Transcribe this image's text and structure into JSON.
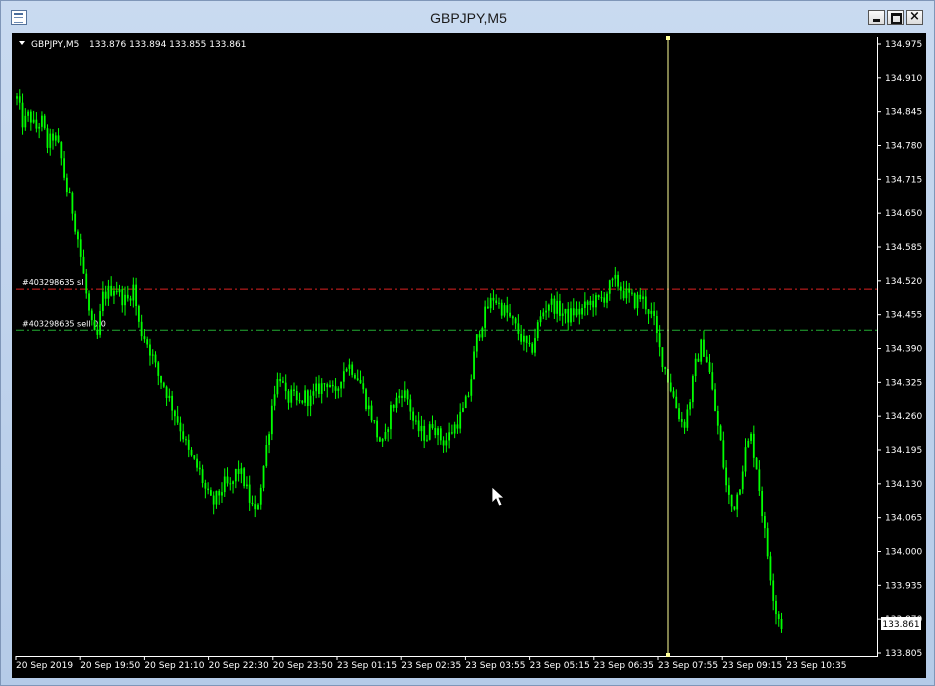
{
  "window": {
    "title": "GBPJPY,M5",
    "controls": [
      "minimize",
      "maximize",
      "close"
    ],
    "close_glyph": "×"
  },
  "chart_data": {
    "type": "candlestick",
    "symbol": "GBPJPY,M5",
    "ohlc_header": "133.876 133.894 133.855 133.861",
    "ylim": [
      133.805,
      134.975
    ],
    "y_ticks": [
      "134.975",
      "134.910",
      "134.845",
      "134.780",
      "134.715",
      "134.650",
      "134.585",
      "134.520",
      "134.455",
      "134.390",
      "134.325",
      "134.260",
      "134.195",
      "134.130",
      "134.065",
      "134.000",
      "133.935",
      "133.870",
      "133.805"
    ],
    "x_ticks": [
      "20 Sep 2019",
      "20 Sep 19:50",
      "20 Sep 21:10",
      "20 Sep 22:30",
      "20 Sep 23:50",
      "23 Sep 01:15",
      "23 Sep 02:35",
      "23 Sep 03:55",
      "23 Sep 05:15",
      "23 Sep 06:35",
      "23 Sep 07:55",
      "23 Sep 09:15",
      "23 Sep 10:35"
    ],
    "current_price": "133.861",
    "grid": false,
    "candle_color": "#00ff00",
    "background": "#000000",
    "close_series": [
      134.87,
      134.82,
      134.84,
      134.81,
      134.83,
      134.78,
      134.8,
      134.77,
      134.7,
      134.66,
      134.6,
      134.52,
      134.44,
      134.4,
      134.49,
      134.5,
      134.51,
      134.49,
      134.48,
      134.51,
      134.43,
      134.41,
      134.38,
      134.34,
      134.32,
      134.29,
      134.26,
      134.23,
      134.19,
      134.17,
      134.15,
      134.11,
      134.09,
      134.11,
      134.13,
      134.12,
      134.16,
      134.14,
      134.1,
      134.07,
      134.14,
      134.22,
      134.31,
      134.34,
      134.29,
      134.3,
      134.28,
      134.3,
      134.29,
      134.31,
      134.32,
      134.33,
      134.29,
      134.34,
      134.36,
      134.35,
      134.33,
      134.29,
      134.26,
      134.22,
      134.2,
      134.27,
      134.29,
      134.31,
      134.29,
      134.24,
      134.23,
      134.22,
      134.25,
      134.22,
      134.21,
      134.23,
      134.25,
      134.27,
      134.31,
      134.4,
      134.44,
      134.47,
      134.49,
      134.47,
      134.46,
      134.44,
      134.42,
      134.4,
      134.38,
      134.43,
      134.46,
      134.48,
      134.47,
      134.46,
      134.45,
      134.46,
      134.46,
      134.47,
      134.48,
      134.48,
      134.49,
      134.51,
      134.52,
      134.5,
      134.49,
      134.48,
      134.49,
      134.47,
      134.45,
      134.39,
      134.35,
      134.31,
      134.27,
      134.24,
      134.29,
      134.36,
      134.4,
      134.36,
      134.28,
      134.21,
      134.12,
      134.08,
      134.12,
      134.19,
      134.22,
      134.16,
      134.06,
      133.97,
      133.89,
      133.86
    ]
  },
  "orders": [
    {
      "label": "#403298635 sl",
      "price": 134.504,
      "color": "#dd2222"
    },
    {
      "label": "#403298635 sell 0.0",
      "price": 134.425,
      "color": "#22aa33"
    }
  ],
  "crosshair": {
    "color": "#ffff99"
  },
  "cursor": "arrow-cursor-icon"
}
